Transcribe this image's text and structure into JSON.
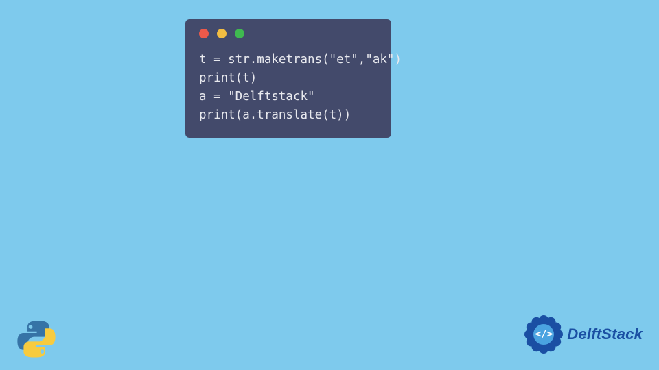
{
  "code": {
    "lines": [
      "t = str.maketrans(\"et\",\"ak\")",
      "print(t)",
      "a = \"Delftstack\"",
      "print(a.translate(t))"
    ]
  },
  "colors": {
    "background": "#7ecaed",
    "window": "#434a6b",
    "traffic_red": "#ed594a",
    "traffic_yellow": "#f2bd42",
    "traffic_green": "#3fb950",
    "code_text": "#e8e9ee",
    "brand_primary": "#1a4fa3",
    "brand_secondary": "#4aa3e0"
  },
  "logos": {
    "python_alt": "Python logo",
    "delftstack_center": "</>",
    "delftstack_text": "DelftStack"
  }
}
